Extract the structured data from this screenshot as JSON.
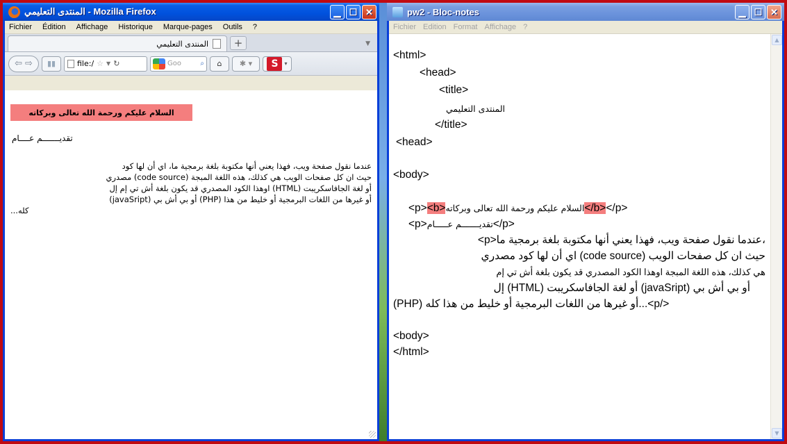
{
  "firefox": {
    "window_title": "المنتدى التعليمي - Mozilla Firefox",
    "menu": [
      "Fichier",
      "Édition",
      "Affichage",
      "Historique",
      "Marque-pages",
      "Outils",
      "?"
    ],
    "tab_label": "المنتدى التعليمي",
    "url": "file:/",
    "search_placeholder": "Goo",
    "greeting": "السلام عليكم ورحمة الله تعالى وبركاته",
    "line2": "تقديـــــــم عــــام",
    "paragraph_lines": [
      "عندما نقول صفحة ويب، فهذا يعني أنها مكتوبة بلغة برمجية ما، اي أن لها كود",
      "حيث ان كل صفحات الويب هي كذلك، هذه اللغة المبجة (code source) مصدري",
      "أو لغة الجافاسكريبت (HTML) اوهذا الكود المصدري قد يكون بلغة أش تي إم إل",
      "أو غيرها من اللغات البرمجية أو خليط من هذا (PHP) أو بي أش بي (javaSript)",
      "...كله"
    ]
  },
  "notepad": {
    "window_title": "pw2 - Bloc-notes",
    "menu": [
      "Fichier",
      "Edition",
      "Format",
      "Affichage",
      "?"
    ],
    "lines": {
      "html_open": "<html>",
      "head_open": "<head>",
      "title_open": "<title>",
      "title_text": "المنتدى التعليمي",
      "title_close": "</title>",
      "head_close": "<head>",
      "body_open": "<body>",
      "p1_open": "<p>",
      "p1_b_open": "<b>",
      "p1_text": "السلام عليكم ورحمة الله تعالى وبركاته",
      "p1_b_close": "</b>",
      "p1_close": "</p>",
      "p2_open": "<p>",
      "p2_text": "تقديـــــــم عـــــام",
      "p2_close": "</p>",
      "p3_l1": "،عندما نقول صفحة ويب، فهذا يعني أنها مكتوبة بلغة برمجية ما<p>",
      "p3_l2": "حيث ان كل صفحات الويب (code source) اي أن لها كود مصدري",
      "p3_l3": "هي كذلك، هذه اللغة المبجة اوهذا الكود المصدري قد يكون بلغة أش تي إم",
      "p3_l4": "أو بي أش بي (javaSript) أو لغة الجافاسكريبت (HTML) إل",
      "p3_l5": "</p>...أو غيرها من اللغات البرمجية أو خليط من هذا كله (PHP)",
      "body_close": "<body>",
      "html_close": "</html>"
    }
  }
}
